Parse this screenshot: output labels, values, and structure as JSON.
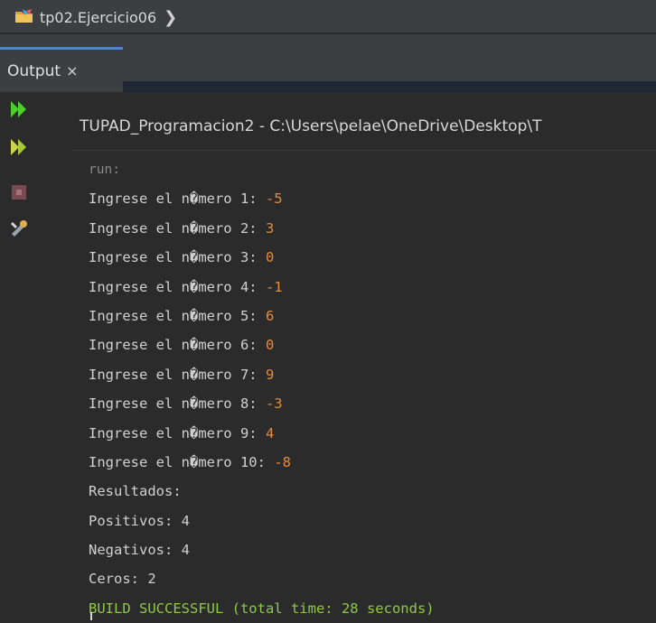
{
  "breadcrumb": {
    "label": "tp02.Ejercicio06",
    "icon": "project-folder-icon"
  },
  "tab": {
    "label": "Output",
    "close": "×"
  },
  "output": {
    "title": "TUPAD_Programacion2 - C:\\Users\\pelae\\OneDrive\\Desktop\\T",
    "run_label": "run:",
    "prompts": [
      {
        "label": "Ingrese el n�mero 1: ",
        "value": "-5"
      },
      {
        "label": "Ingrese el n�mero 2: ",
        "value": "3"
      },
      {
        "label": "Ingrese el n�mero 3: ",
        "value": "0"
      },
      {
        "label": "Ingrese el n�mero 4: ",
        "value": "-1"
      },
      {
        "label": "Ingrese el n�mero 5: ",
        "value": "6"
      },
      {
        "label": "Ingrese el n�mero 6: ",
        "value": "0"
      },
      {
        "label": "Ingrese el n�mero 7: ",
        "value": "9"
      },
      {
        "label": "Ingrese el n�mero 8: ",
        "value": "-3"
      },
      {
        "label": "Ingrese el n�mero 9: ",
        "value": "4"
      },
      {
        "label": "Ingrese el n�mero 10: ",
        "value": "-8"
      }
    ],
    "results": [
      "Resultados:",
      "Positivos: 4",
      "Negativos: 4",
      "Ceros: 2"
    ],
    "build_status": "BUILD SUCCESSFUL (total time: 28 seconds)"
  },
  "colors": {
    "background": "#2b2b2b",
    "input_value": "#e38c3c",
    "success": "#8fc74a",
    "run_icon": "#4ccf2a"
  }
}
